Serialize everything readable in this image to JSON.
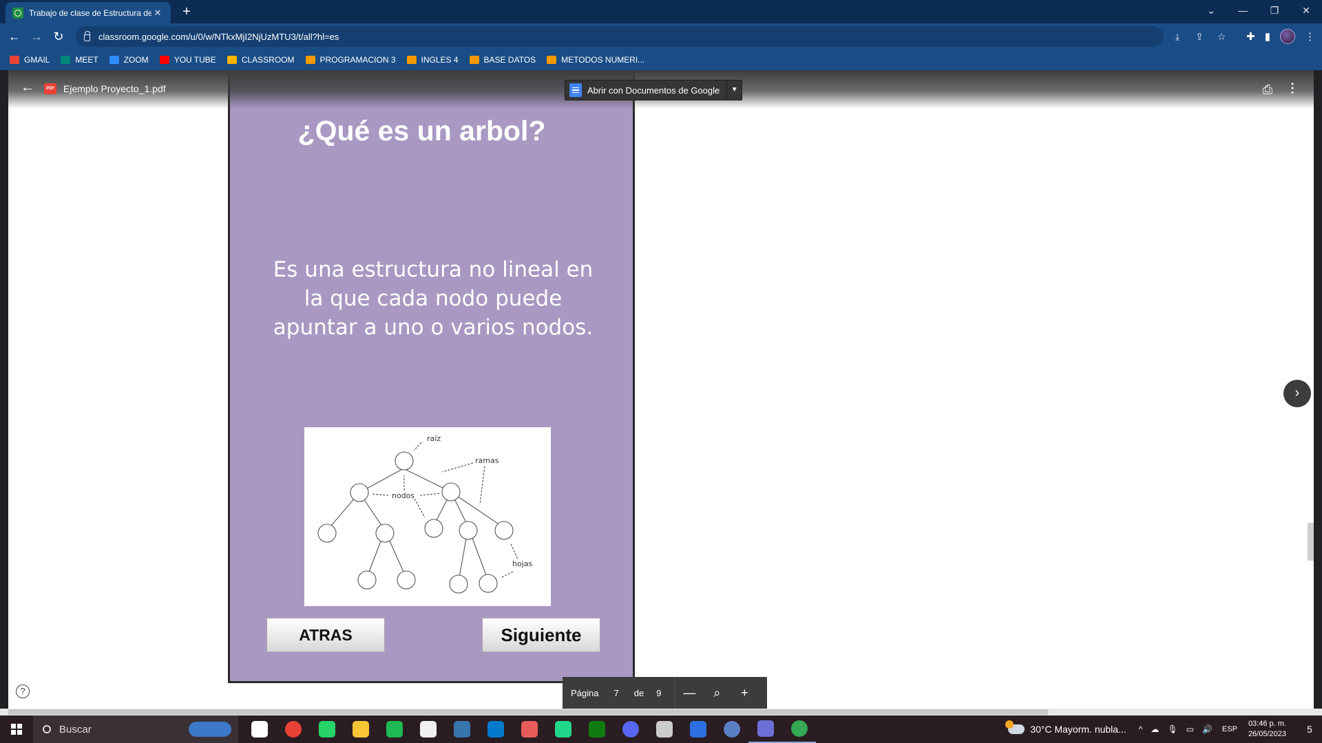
{
  "browser": {
    "tab_title": "Trabajo de clase de Estructura de",
    "tab_close": "✕",
    "new_tab": "+",
    "url": "classroom.google.com/u/0/w/NTkxMjI2NjUzMTU3/t/all?hl=es",
    "window_controls": [
      "⌄",
      "—",
      "❐",
      "✕"
    ]
  },
  "bookmarks": [
    {
      "label": "GMAIL",
      "icon": "gmail-icon",
      "color": "#ea4335"
    },
    {
      "label": "MEET",
      "icon": "meet-icon",
      "color": "#00897b"
    },
    {
      "label": "ZOOM",
      "icon": "zoom-icon",
      "color": "#2d8cff"
    },
    {
      "label": "YOU TUBE",
      "icon": "youtube-icon",
      "color": "#ff0000"
    },
    {
      "label": "CLASSROOM",
      "icon": "classroom-icon",
      "color": "#f4b400"
    },
    {
      "label": "PROGRAMACION 3",
      "icon": "folder-icon",
      "color": "#f29900"
    },
    {
      "label": "INGLES 4",
      "icon": "folder-icon",
      "color": "#f29900"
    },
    {
      "label": "BASE DATOS",
      "icon": "folder-icon",
      "color": "#f29900"
    },
    {
      "label": "METODOS NUMERI...",
      "icon": "folder-icon",
      "color": "#f29900"
    }
  ],
  "viewer": {
    "file_name": "Ejemplo Proyecto_1.pdf",
    "open_with": "Abrir con Documentos de Google",
    "page_label": "Página",
    "current_page": "7",
    "of_label": "de",
    "total_pages": "9"
  },
  "slide": {
    "title": "¿Qué es un arbol?",
    "body": "Es una estructura no lineal en la que cada nodo puede apuntar a uno o varios nodos.",
    "diagram_labels": {
      "root": "raíz",
      "branches": "ramas",
      "nodes": "nodos",
      "leaves": "hojas"
    },
    "back_button": "ATRAS",
    "next_button": "Siguiente",
    "background_color": "#a898c2"
  },
  "taskbar": {
    "search_placeholder": "Buscar",
    "weather": "30°C  Mayorm. nubla...",
    "language": "ESP",
    "time": "03:46 p. m.",
    "date": "26/05/2023",
    "notifications": "5",
    "apps": [
      {
        "name": "task-view-icon",
        "color": "#ffffff"
      },
      {
        "name": "chrome-icon",
        "color": "#ea4335"
      },
      {
        "name": "whatsapp-icon",
        "color": "#25d366"
      },
      {
        "name": "file-explorer-icon",
        "color": "#f8c537"
      },
      {
        "name": "spotify-icon",
        "color": "#1db954"
      },
      {
        "name": "inkscape-icon",
        "color": "#f0f0f0"
      },
      {
        "name": "python-icon",
        "color": "#3776ab"
      },
      {
        "name": "vscode-icon",
        "color": "#007acc"
      },
      {
        "name": "jetbrains-icon",
        "color": "#e85b5b"
      },
      {
        "name": "pycharm-icon",
        "color": "#21d789"
      },
      {
        "name": "xbox-icon",
        "color": "#107c10"
      },
      {
        "name": "discord-icon",
        "color": "#5865f2"
      },
      {
        "name": "teams-icon",
        "color": "#cccccc"
      },
      {
        "name": "app-icon",
        "color": "#2d6fe0"
      },
      {
        "name": "r-icon",
        "color": "#5b7fc4"
      },
      {
        "name": "editor-icon",
        "color": "#6b6fd6"
      },
      {
        "name": "chrome-profile-icon",
        "color": "#34a853"
      }
    ]
  }
}
